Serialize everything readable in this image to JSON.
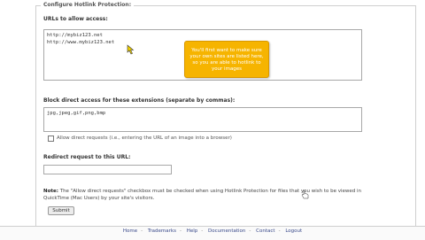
{
  "section": {
    "legend": "Configure Hotlink Protection:"
  },
  "urls": {
    "label": "URLs to allow access:",
    "value": "http://mybiz123.net\nhttp://www.mybiz123.net"
  },
  "callout": {
    "text": "You'll first want to make sure your own sites are listed here, so you are able to hotlink to your images"
  },
  "extensions": {
    "label": "Block direct access for these extensions (separate by commas):",
    "value": "jpg,jpeg,gif,png,bmp"
  },
  "allow_direct": {
    "label": "Allow direct requests (i.e., entering the URL of an image into a browser)",
    "checked": false
  },
  "redirect": {
    "label": "Redirect request to this URL:",
    "value": ""
  },
  "note": {
    "title": "Note:",
    "text": "The \"Allow direct requests\" checkbox must be checked when using Hotlink Protection for files that you wish to be viewed in QuickTime (Mac Users) by your site's visitors."
  },
  "submit_label": "Submit",
  "footer": {
    "links": [
      "Home",
      "Trademarks",
      "Help",
      "Documentation",
      "Contact",
      "Logout"
    ],
    "separator": "-"
  },
  "colors": {
    "callout_bg": "#f6b400",
    "link": "#3a4a8a"
  }
}
